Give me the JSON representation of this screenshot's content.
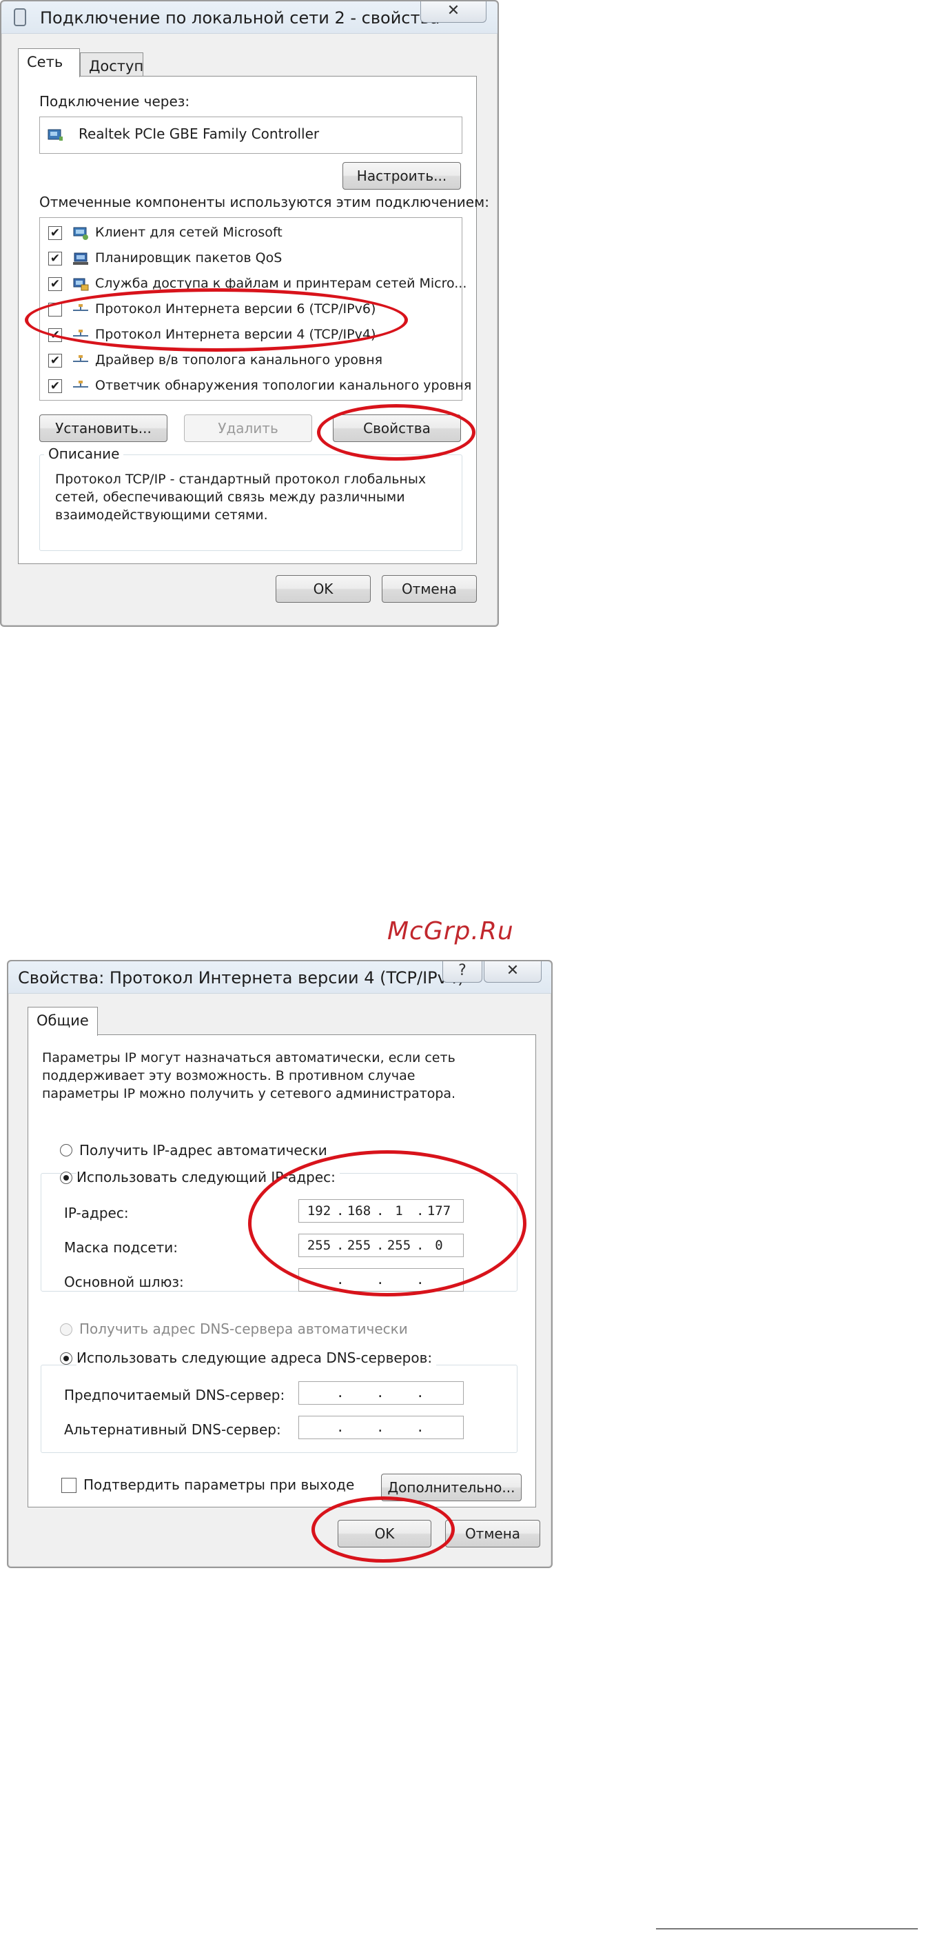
{
  "dialog1": {
    "title": "Подключение по локальной сети 2 - свойства",
    "close_glyph": "✕",
    "tabs": [
      {
        "label": "Сеть",
        "active": true
      },
      {
        "label": "Доступ",
        "active": false
      }
    ],
    "connect_via_label": "Подключение через:",
    "adapter_name": "Realtek PCIe GBE Family Controller",
    "configure_button": "Настроить...",
    "components_label": "Отмеченные компоненты используются этим подключением:",
    "components": [
      {
        "label": "Клиент для сетей Microsoft",
        "checked": true,
        "icon": "network-client-icon"
      },
      {
        "label": "Планировщик пакетов QoS",
        "checked": true,
        "icon": "qos-scheduler-icon"
      },
      {
        "label": "Служба доступа к файлам и принтерам сетей Micro...",
        "checked": true,
        "icon": "file-sharing-icon"
      },
      {
        "label": "Протокол Интернета версии 6 (TCP/IPv6)",
        "checked": false,
        "icon": "protocol-icon"
      },
      {
        "label": "Протокол Интернета версии 4 (TCP/IPv4)",
        "checked": true,
        "icon": "protocol-icon"
      },
      {
        "label": "Драйвер в/в тополога канального уровня",
        "checked": true,
        "icon": "protocol-icon"
      },
      {
        "label": "Ответчик обнаружения топологии канального уровня",
        "checked": true,
        "icon": "protocol-icon"
      }
    ],
    "install_button": "Установить...",
    "remove_button": "Удалить",
    "properties_button": "Свойства",
    "description_title": "Описание",
    "description_text": "Протокол TCP/IP - стандартный протокол глобальных сетей, обеспечивающий связь между различными взаимодействующими сетями.",
    "ok_button": "OK",
    "cancel_button": "Отмена"
  },
  "watermark": "McGrp.Ru",
  "dialog2": {
    "title": "Свойства: Протокол Интернета версии 4 (TCP/IPv4)",
    "help_glyph": "?",
    "close_glyph": "✕",
    "tab_label": "Общие",
    "intro_text": "Параметры IP могут назначаться автоматически, если сеть поддерживает эту возможность. В противном случае параметры IP можно получить у сетевого администратора.",
    "radio_auto_ip": {
      "label": "Получить IP-адрес автоматически",
      "selected": false
    },
    "radio_manual_ip": {
      "label": "Использовать следующий IP-адрес:",
      "selected": true
    },
    "ip_label": "IP-адрес:",
    "ip_value": [
      "192",
      "168",
      "1",
      "177"
    ],
    "mask_label": "Маска подсети:",
    "mask_value": [
      "255",
      "255",
      "255",
      "0"
    ],
    "gateway_label": "Основной шлюз:",
    "gateway_value": [
      "",
      "",
      "",
      ""
    ],
    "radio_auto_dns": {
      "label": "Получить адрес DNS-сервера автоматически",
      "selected": false,
      "disabled": true
    },
    "radio_manual_dns": {
      "label": "Использовать следующие адреса DNS-серверов:",
      "selected": true
    },
    "preferred_dns_label": "Предпочитаемый DNS-сервер:",
    "preferred_dns_value": [
      "",
      "",
      "",
      ""
    ],
    "alternate_dns_label": "Альтернативный DNS-сервер:",
    "alternate_dns_value": [
      "",
      "",
      "",
      ""
    ],
    "validate_checkbox_label": "Подтвердить параметры при выходе",
    "validate_checked": false,
    "advanced_button": "Дополнительно...",
    "ok_button": "OK",
    "cancel_button": "Отмена"
  },
  "highlight_color": "#d8131b"
}
